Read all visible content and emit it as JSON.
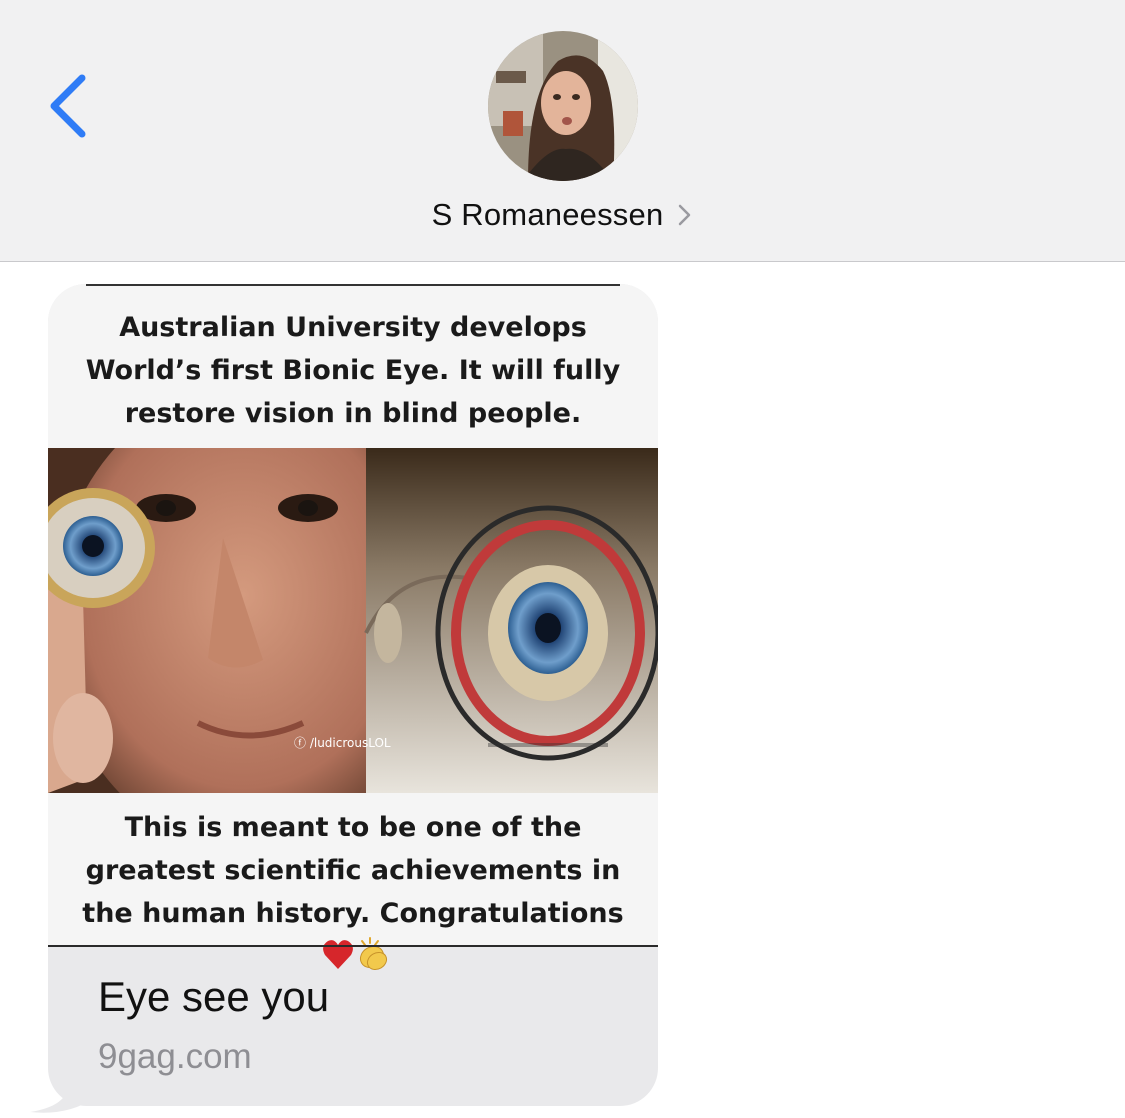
{
  "header": {
    "contact_name": "S Romaneessen",
    "back_icon": "chevron-left-icon",
    "disclosure_icon": "chevron-right-icon",
    "accent_color": "#2f7cf6"
  },
  "message": {
    "meme": {
      "caption_top": "Australian University develops World’s first Bionic Eye. It will fully restore vision in blind people.",
      "caption_bottom": "This is meant to be one of the greatest scientific achievements in the human history. Congratulations",
      "emoji": [
        "red-heart-icon",
        "clapping-hands-icon"
      ],
      "watermark": "/ludicrousLOL"
    },
    "link_preview": {
      "title": "Eye see you",
      "domain": "9gag.com"
    },
    "bubble_color": "#e9e9eb"
  }
}
